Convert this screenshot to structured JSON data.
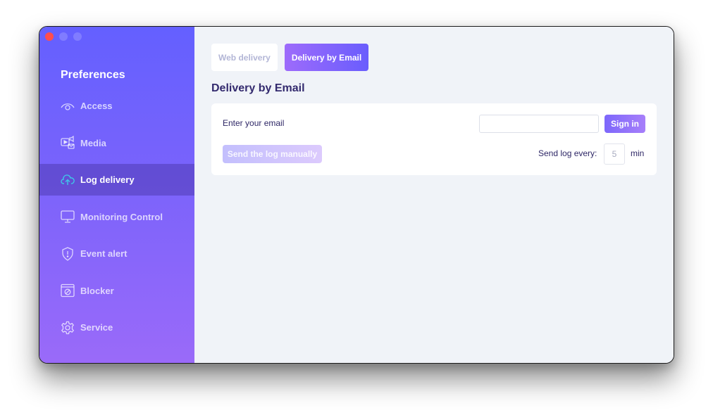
{
  "window": {
    "controls": [
      "close",
      "minimize",
      "maximize"
    ]
  },
  "sidebar": {
    "title": "Preferences",
    "items": [
      {
        "label": "Access",
        "icon": "eye-icon",
        "active": false
      },
      {
        "label": "Media",
        "icon": "media-icon",
        "active": false
      },
      {
        "label": "Log delivery",
        "icon": "cloud-upload-icon",
        "active": true
      },
      {
        "label": "Monitoring Control",
        "icon": "monitor-icon",
        "active": false
      },
      {
        "label": "Event alert",
        "icon": "shield-alert-icon",
        "active": false
      },
      {
        "label": "Blocker",
        "icon": "blocked-window-icon",
        "active": false
      },
      {
        "label": "Service",
        "icon": "gear-icon",
        "active": false
      }
    ]
  },
  "tabs": [
    {
      "label": "Web delivery",
      "active": false
    },
    {
      "label": "Delivery by Email",
      "active": true
    }
  ],
  "main": {
    "section_title": "Delivery by Email",
    "email_label": "Enter your email",
    "email_value": "",
    "email_placeholder": "",
    "sign_in_label": "Sign in",
    "send_manual_label": "Send the log manually",
    "send_every_label": "Send log every:",
    "interval_value": "5",
    "interval_unit": "min"
  },
  "colors": {
    "accent": "#6a5dfd",
    "accent_secondary": "#9d6bfb",
    "active_icon": "#3fc6e8",
    "heading_text": "#332a6e",
    "close_button": "#ff4d4d"
  }
}
